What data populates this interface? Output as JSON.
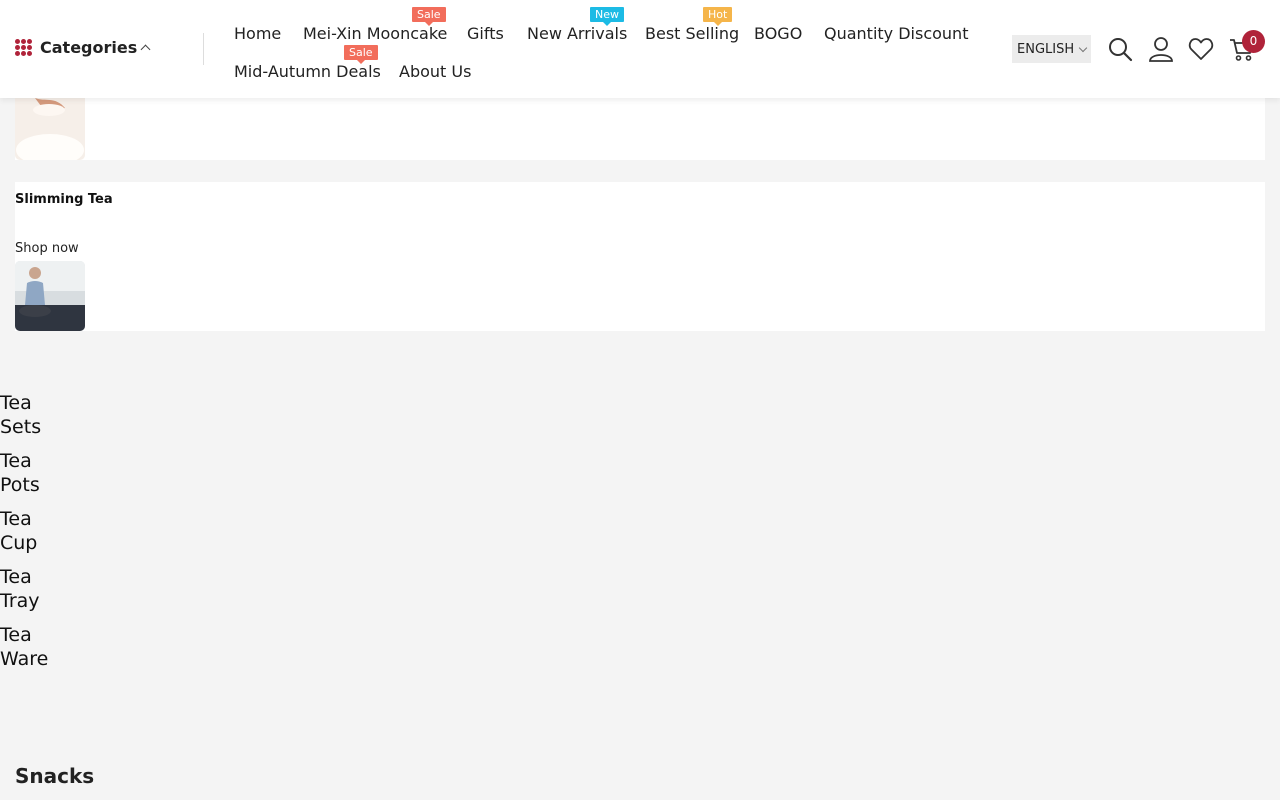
{
  "header": {
    "categories_label": "Categories",
    "nav": {
      "home": "Home",
      "mooncake": "Mei-Xin Mooncake",
      "gifts": "Gifts",
      "new_arrivals": "New Arrivals",
      "best_selling": "Best Selling",
      "bogo": "BOGO",
      "quantity_discount": "Quantity Discount",
      "mid_autumn": "Mid-Autumn Deals",
      "about": "About Us"
    },
    "badges": {
      "mooncake": "Sale",
      "new_arrivals": "New",
      "best_selling": "Hot",
      "mid_autumn": "Sale"
    },
    "language": "ENGLISH",
    "cart_count": "0",
    "icons": [
      "search-icon",
      "user-icon",
      "heart-icon",
      "cart-icon",
      "grid-icon",
      "chevron-up-icon",
      "chevron-down-icon"
    ]
  },
  "cards": {
    "slimming": {
      "title": "Slimming Tea",
      "link": "Shop now"
    }
  },
  "tea_links": [
    "Tea Sets",
    "Tea Pots",
    "Tea Cup",
    "Tea Tray",
    "Tea Ware"
  ],
  "sections": {
    "snacks": "Snacks"
  },
  "colors": {
    "brand": "#b0233a",
    "sale": "#f26d5b",
    "new": "#1cbbe5",
    "hot": "#f5b54a"
  }
}
